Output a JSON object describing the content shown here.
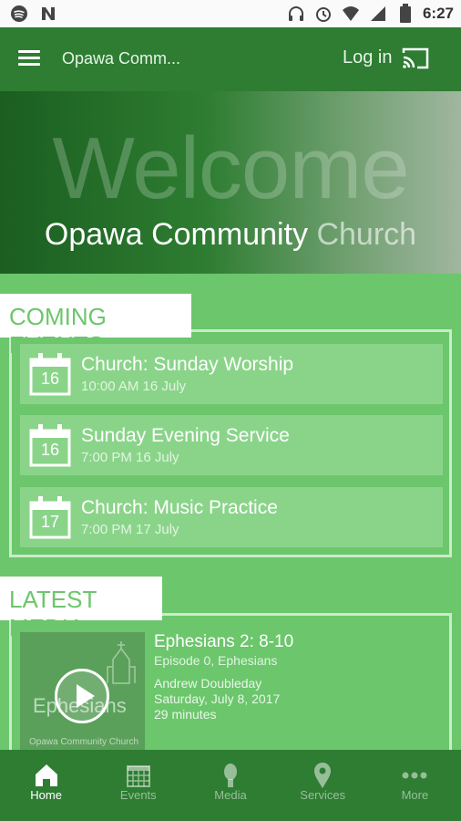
{
  "status_bar": {
    "time": "6:27"
  },
  "app_bar": {
    "title": "Opawa Comm...",
    "login_label": "Log in"
  },
  "hero": {
    "welcome": "Welcome",
    "subtitle_main": "Opawa Community",
    "subtitle_light": "Church"
  },
  "events_section": {
    "title": "COMING EVENTS",
    "items": [
      {
        "day": "16",
        "title": "Church: Sunday Worship",
        "time": "10:00 AM 16 July"
      },
      {
        "day": "16",
        "title": "Sunday Evening Service",
        "time": "7:00 PM 16 July"
      },
      {
        "day": "17",
        "title": "Church: Music Practice",
        "time": "7:00 PM 17 July"
      }
    ]
  },
  "media_section": {
    "title": "LATEST MEDIA",
    "thumb_word": "Ephesians",
    "thumb_church": "Opawa Community Church",
    "item": {
      "title": "Ephesians 2: 8-10",
      "episode": "Episode 0, Ephesians",
      "speaker": "Andrew Doubleday",
      "date": "Saturday, July 8, 2017",
      "duration": "29 minutes"
    }
  },
  "bottom_nav": {
    "items": [
      {
        "label": "Home",
        "icon": "home-icon",
        "active": true
      },
      {
        "label": "Events",
        "icon": "calendar-icon",
        "active": false
      },
      {
        "label": "Media",
        "icon": "microphone-icon",
        "active": false
      },
      {
        "label": "Services",
        "icon": "location-pin-icon",
        "active": false
      },
      {
        "label": "More",
        "icon": "more-dots-icon",
        "active": false
      }
    ]
  },
  "colors": {
    "primary": "#2e7d32",
    "background": "#6cc66c",
    "card": "#8ad48a"
  }
}
